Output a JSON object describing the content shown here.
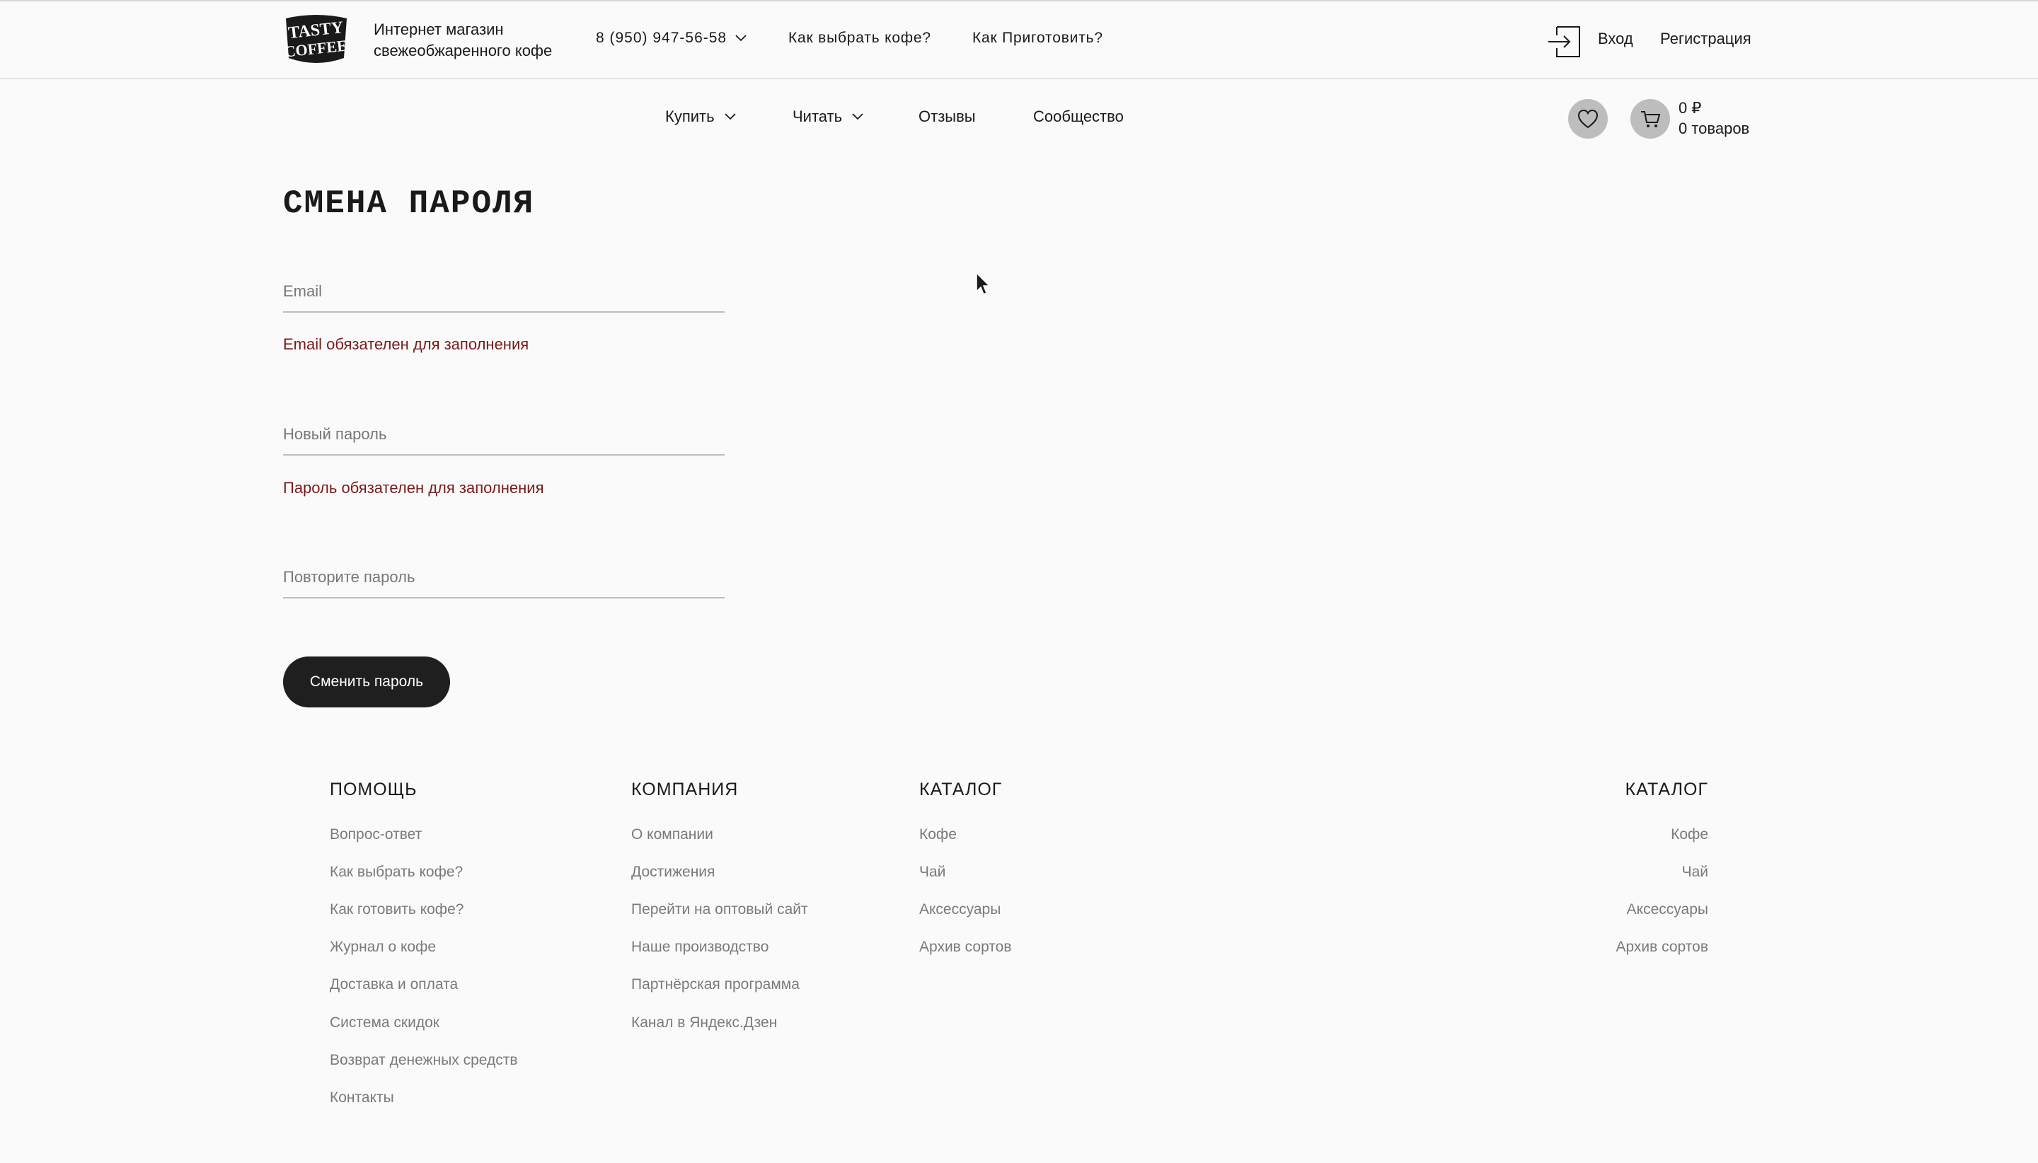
{
  "header": {
    "logo_text": "TASTY COFFEE",
    "tagline_line1": "Интернет магазин",
    "tagline_line2": "свежеобжаренного кофе",
    "phone": "8 (950) 947-56-58",
    "links": [
      "Как выбрать кофе?",
      "Как Приготовить?"
    ],
    "login": "Вход",
    "register": "Регистрация"
  },
  "nav": {
    "items": [
      {
        "label": "Купить",
        "dropdown": true
      },
      {
        "label": "Читать",
        "dropdown": true
      },
      {
        "label": "Отзывы",
        "dropdown": false
      },
      {
        "label": "Сообщество",
        "dropdown": false
      }
    ],
    "cart_total": "0 ₽",
    "cart_count": "0 товаров"
  },
  "form": {
    "title": "СМЕНА ПАРОЛЯ",
    "email_placeholder": "Email",
    "email_error": "Email обязателен для заполнения",
    "new_password_placeholder": "Новый пароль",
    "password_error": "Пароль обязателен для заполнения",
    "repeat_password_placeholder": "Повторите пароль",
    "submit_label": "Сменить пароль"
  },
  "footer": {
    "help": {
      "title": "ПОМОЩЬ",
      "links": [
        "Вопрос-ответ",
        "Как выбрать кофе?",
        "Как готовить кофе?",
        "Журнал о кофе",
        "Доставка и оплата",
        "Система скидок",
        "Возврат денежных средств",
        "Контакты"
      ]
    },
    "company": {
      "title": "КОМПАНИЯ",
      "links": [
        "О компании",
        "Достижения",
        "Перейти на оптовый сайт",
        "Наше производство",
        "Партнёрская программа",
        "Канал в Яндекс.Дзен"
      ]
    },
    "catalog": {
      "title": "КАТАЛОГ",
      "links": [
        "Кофе",
        "Чай",
        "Аксессуары",
        "Архив сортов"
      ]
    },
    "catalog_right": {
      "title": "КАТАЛОГ",
      "links": [
        "Кофе",
        "Чай",
        "Аксессуары",
        "Архив сортов"
      ]
    }
  },
  "colors": {
    "background": "#fafafa",
    "text": "#1a1a1a",
    "error": "#7a1a1a",
    "button": "#1f1f1f",
    "muted": "#7a7a7a"
  }
}
